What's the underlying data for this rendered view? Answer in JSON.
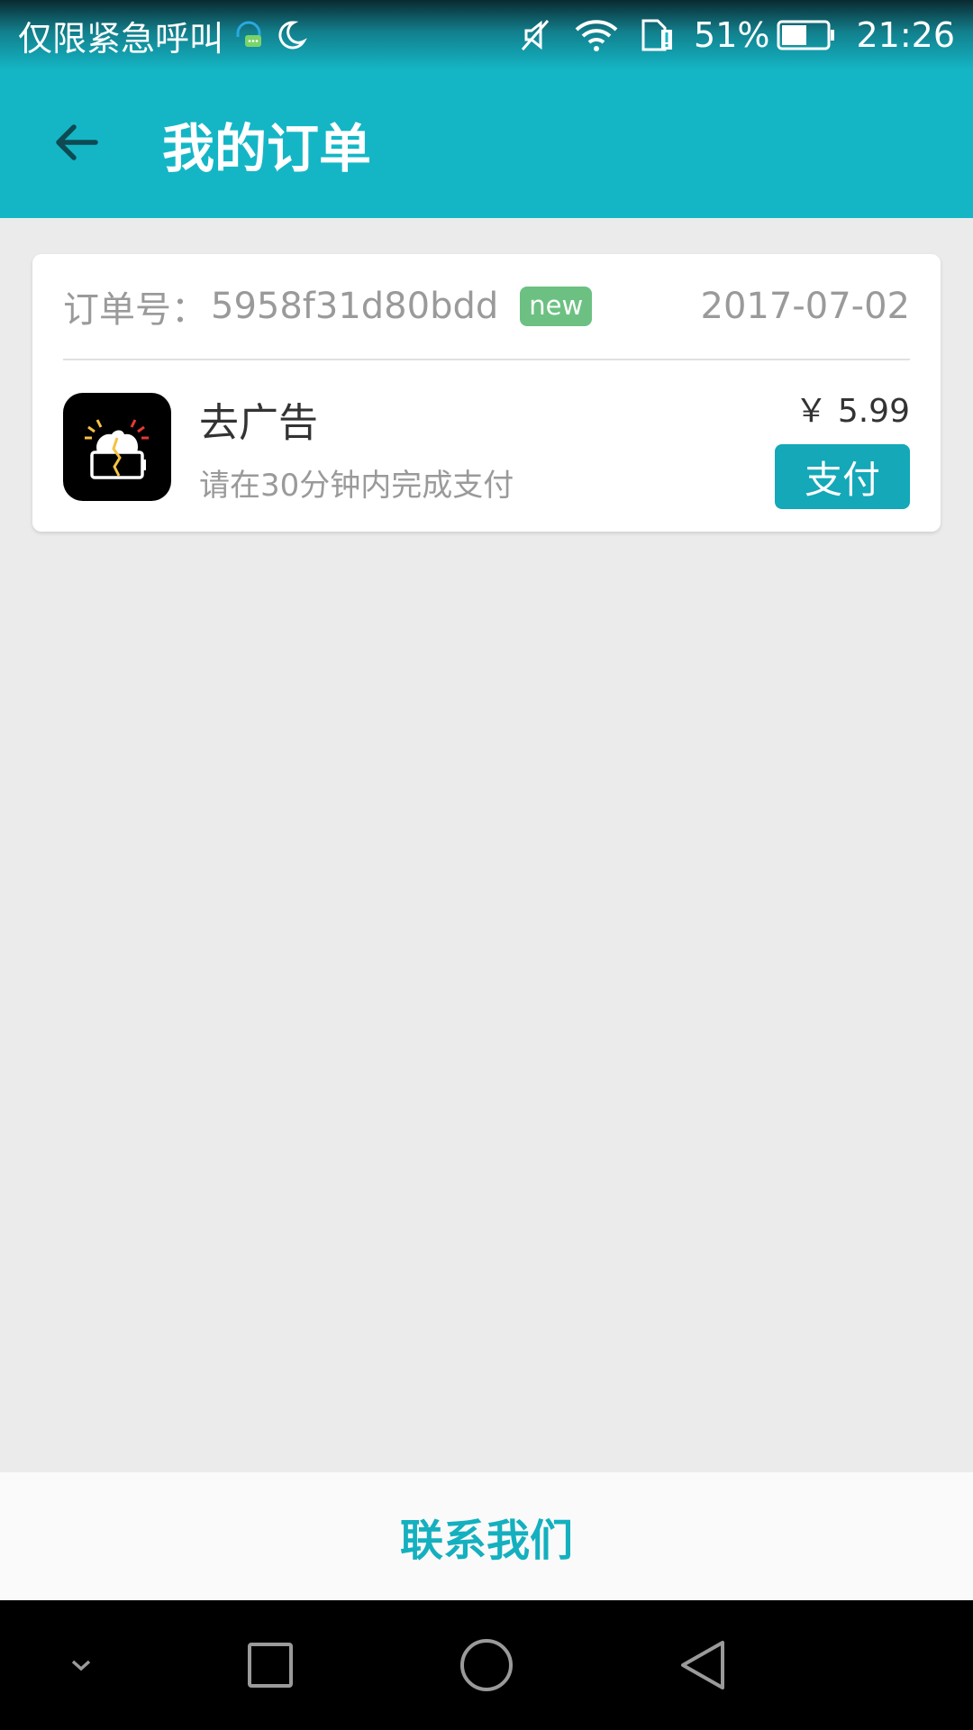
{
  "status_bar": {
    "carrier": "仅限紧急呼叫",
    "battery": "51%",
    "time": "21:26",
    "icons": [
      "headset-chat-icon",
      "moon-icon",
      "mute-icon",
      "wifi-icon",
      "sim-alert-icon",
      "battery-icon"
    ]
  },
  "app_bar": {
    "title": "我的订单",
    "back_icon": "arrow-left-icon"
  },
  "order": {
    "label": "订单号：",
    "number": "5958f31d80bdd",
    "badge": "new",
    "date": "2017-07-02",
    "item_name": "去广告",
    "item_subtitle": "请在30分钟内完成支付",
    "price": "￥ 5.99",
    "pay_label": "支付",
    "icon": "broken-battery-brain-icon"
  },
  "footer": {
    "contact_label": "联系我们"
  },
  "nav_bar": {
    "buttons": [
      "chevron-down-icon",
      "square-recents-icon",
      "circle-home-icon",
      "triangle-back-icon"
    ]
  },
  "colors": {
    "primary": "#14b6c6",
    "badge": "#6cc182",
    "pay_button": "#14a8b8"
  }
}
